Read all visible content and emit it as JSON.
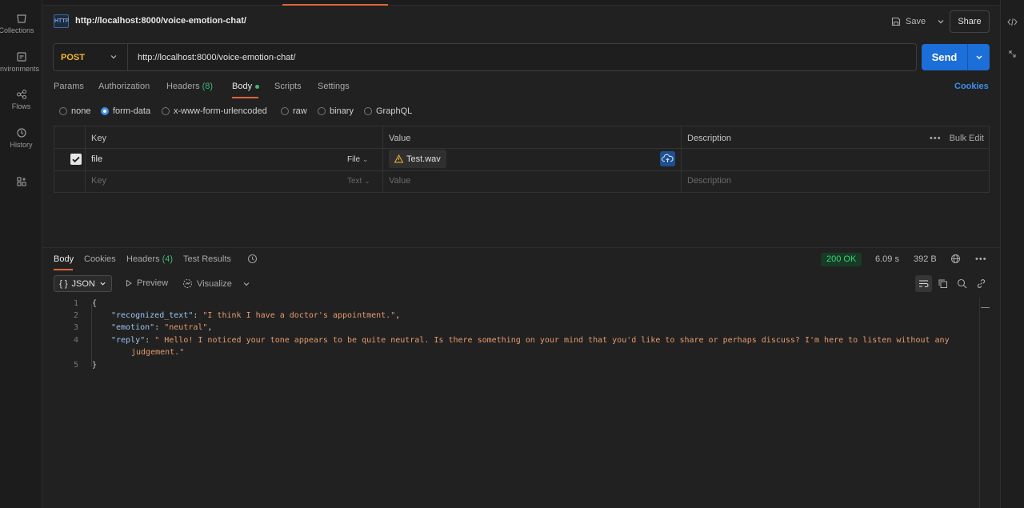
{
  "sidebar": {
    "items": [
      {
        "label": "Collections",
        "icon": "collections-icon"
      },
      {
        "label": "Environments",
        "icon": "environments-icon"
      },
      {
        "label": "Flows",
        "icon": "flows-icon"
      },
      {
        "label": "History",
        "icon": "history-icon"
      },
      {
        "label": "",
        "icon": "apps-icon"
      }
    ]
  },
  "header": {
    "badge": "HTTP",
    "title": "http://localhost:8000/voice-emotion-chat/",
    "save_label": "Save",
    "share_label": "Share"
  },
  "request": {
    "method": "POST",
    "url": "http://localhost:8000/voice-emotion-chat/",
    "send_label": "Send"
  },
  "tabs": {
    "params": "Params",
    "authorization": "Authorization",
    "headers": "Headers",
    "headers_count": "(8)",
    "body": "Body",
    "scripts": "Scripts",
    "settings": "Settings",
    "cookies": "Cookies"
  },
  "body_modes": [
    "none",
    "form-data",
    "x-www-form-urlencoded",
    "raw",
    "binary",
    "GraphQL"
  ],
  "form_table": {
    "headers": {
      "key": "Key",
      "value": "Value",
      "description": "Description",
      "bulk_edit": "Bulk Edit"
    },
    "rows": [
      {
        "key": "file",
        "type": "File",
        "value": "Test.wav",
        "description": ""
      }
    ],
    "placeholder": {
      "key": "Key",
      "type": "Text",
      "value": "Value",
      "description": "Description"
    }
  },
  "response": {
    "tabs": {
      "body": "Body",
      "cookies": "Cookies",
      "headers": "Headers",
      "headers_count": "(4)",
      "test_results": "Test Results"
    },
    "status": "200 OK",
    "time": "6.09 s",
    "size": "392 B",
    "format": "JSON",
    "preview": "Preview",
    "visualize": "Visualize",
    "line_numbers": [
      "1",
      "2",
      "3",
      "4",
      "",
      "5"
    ],
    "json": {
      "open": "{",
      "k1": "\"recognized_text\"",
      "v1": "\"I think I have a doctor's appointment.\"",
      "k2": "\"emotion\"",
      "v2": "\"neutral\"",
      "k3": "\"reply\"",
      "v3a": "\" Hello! I noticed your tone appears to be quite neutral. Is there something on your mind that you'd like to share or perhaps discuss? I'm here to listen without any",
      "v3b": "judgement.\"",
      "close": "}"
    }
  }
}
